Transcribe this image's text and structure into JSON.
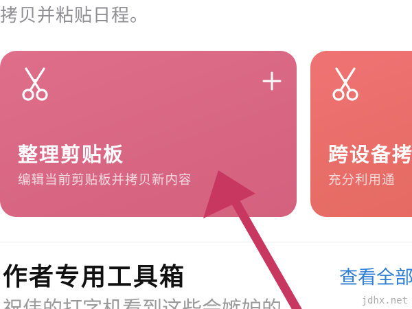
{
  "header": {
    "text": "拷贝并粘贴日程。"
  },
  "cards": [
    {
      "title": "整理剪贴板",
      "subtitle": "编辑当前剪贴板并拷贝新内容",
      "icon": "scissors-icon",
      "action_icon": "plus-icon",
      "color": "#d9667f"
    },
    {
      "title": "跨设备拷",
      "subtitle": "充分利用通",
      "icon": "scissors-icon",
      "color": "#ea6f6b"
    }
  ],
  "section": {
    "title": "作者专用工具箱",
    "see_all": "查看全部",
    "description": "祝伟的打字机看到这些会嫉妒的"
  },
  "watermark": "jdhx.net",
  "annotation": {
    "arrow_color": "#c8375f"
  }
}
